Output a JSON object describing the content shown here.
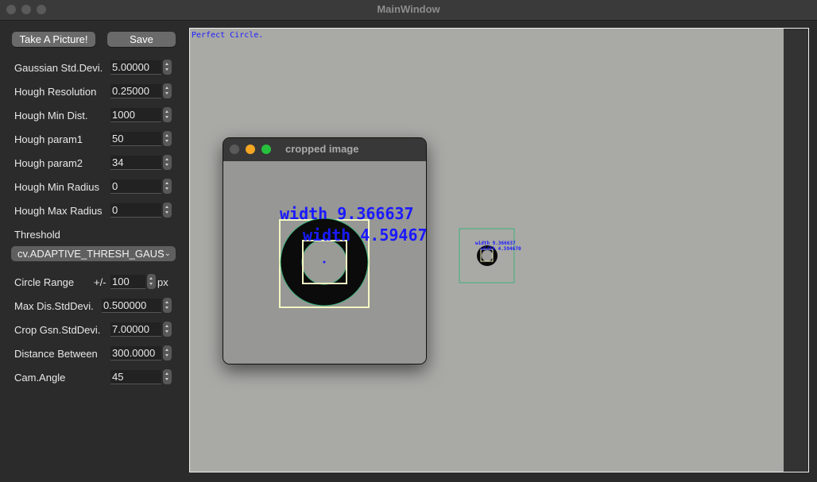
{
  "window": {
    "title": "MainWindow"
  },
  "toolbar": {
    "take_picture": "Take A Picture!",
    "save": "Save"
  },
  "params": {
    "gaussian": {
      "label": "Gaussian Std.Devi.",
      "value": "5.00000"
    },
    "hough_res": {
      "label": "Hough Resolution",
      "value": "0.25000"
    },
    "hough_min_dist": {
      "label": "Hough Min Dist.",
      "value": "1000"
    },
    "hough_param1": {
      "label": "Hough param1",
      "value": "50"
    },
    "hough_param2": {
      "label": "Hough param2",
      "value": "34"
    },
    "hough_min_radius": {
      "label": "Hough Min Radius",
      "value": "0"
    },
    "hough_max_radius": {
      "label": "Hough Max Radius",
      "value": "0"
    },
    "threshold": {
      "label": "Threshold",
      "value": "cv.ADAPTIVE_THRESH_GAUS"
    },
    "circle_range": {
      "label": "Circle Range",
      "prefix": "+/-",
      "value": "100",
      "unit": "px"
    },
    "max_dis": {
      "label": "Max Dis.StdDevi.",
      "value": "0.500000"
    },
    "crop_gsn": {
      "label": "Crop Gsn.StdDevi.",
      "value": "7.00000"
    },
    "distance_between": {
      "label": "Distance Between",
      "value": "300.0000"
    },
    "cam_angle": {
      "label": "Cam.Angle",
      "value": "45"
    }
  },
  "image": {
    "status": "Perfect Circle.",
    "small_width_label": "width 9.366637",
    "small_width2_label": "width 4.594670"
  },
  "cropped": {
    "title": "cropped image",
    "width_label": "width 9.366637",
    "width2_label": "width 4.59467"
  },
  "colors": {
    "annotation": "#1a1aff",
    "green_box": "#3fb37a",
    "yellow_box": "#f4f7c4"
  }
}
